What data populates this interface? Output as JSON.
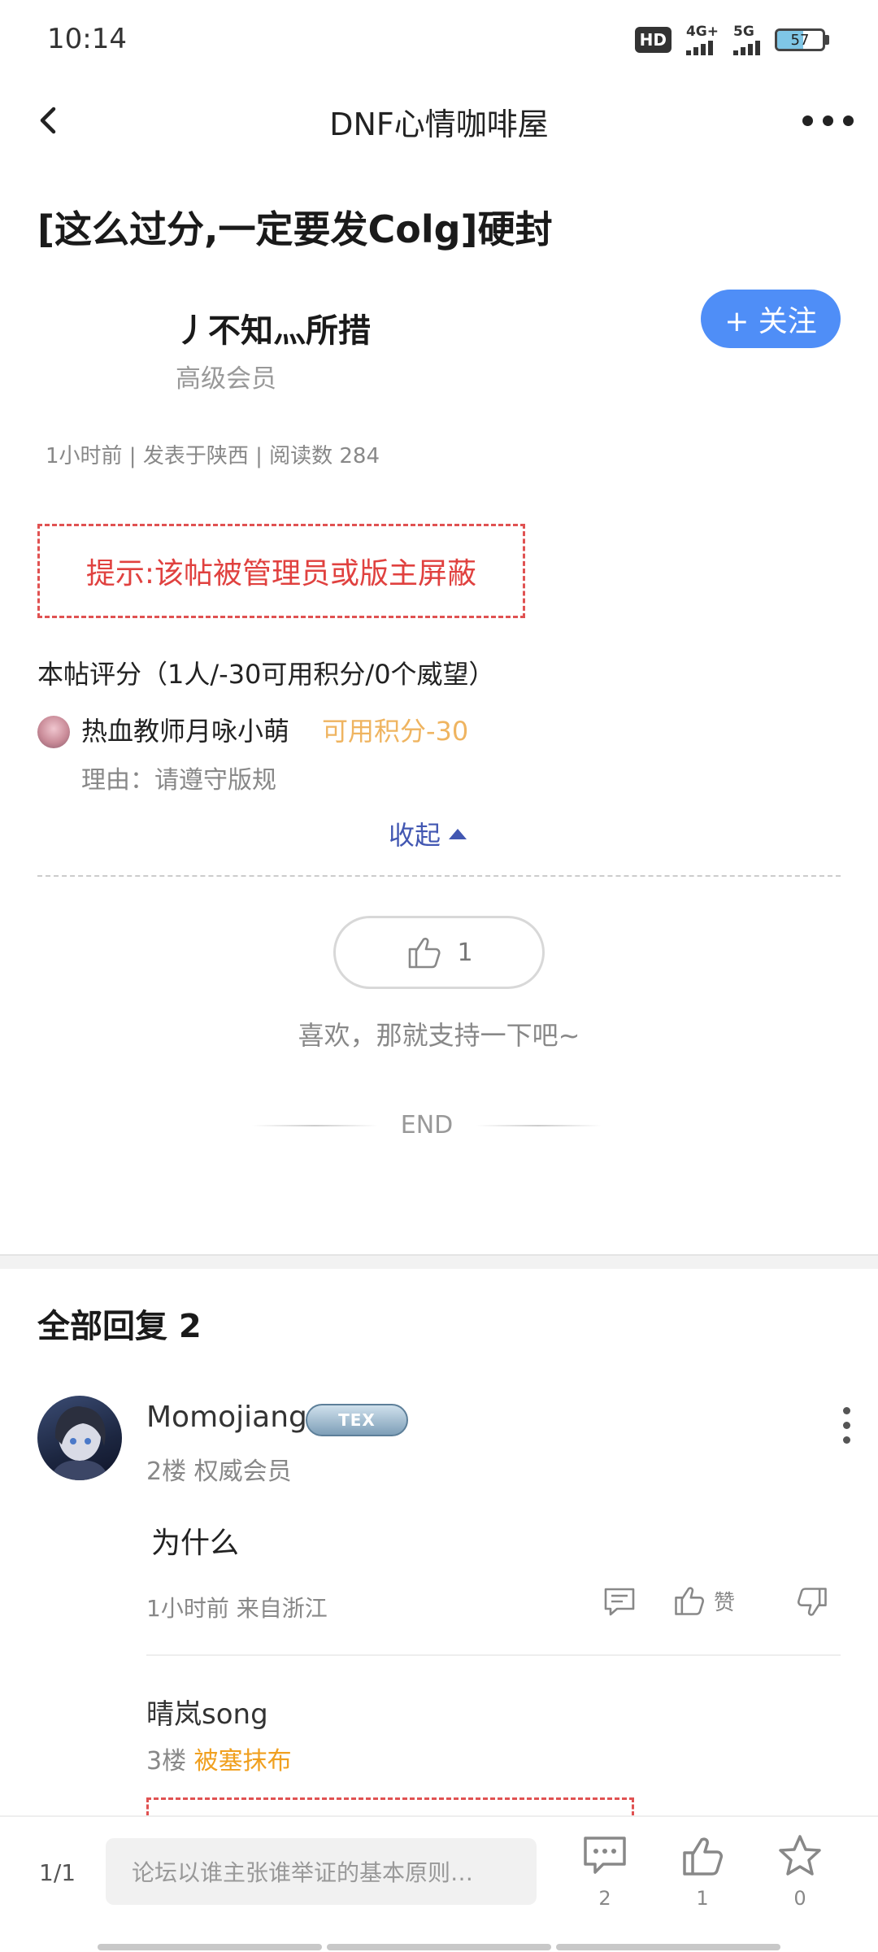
{
  "status_bar": {
    "time": "10:14",
    "hd_label": "HD",
    "network_1": "4G+",
    "network_2": "5G",
    "battery": "57",
    "battery_level": 0.57
  },
  "nav": {
    "title": "DNF心情咖啡屋",
    "back_icon": "chevron-left-icon",
    "more_icon": "more-horizontal-icon"
  },
  "post": {
    "title": "[这么过分,一定要发Colg]硬封",
    "author_name": "丿不知灬所措",
    "author_rank": "高级会员",
    "follow_label": "+ 关注",
    "meta": "1小时前 | 发表于陕西 | 阅读数 284",
    "notice": "提示:该帖被管理员或版主屏蔽",
    "rating_header": "本帖评分（1人/-30可用积分/0个威望）",
    "rater_name": "热血教师月咏小萌",
    "rater_score": "可用积分-30",
    "rater_reason": "理由：请遵守版规",
    "collapse_label": "收起",
    "like_count": "1",
    "like_hint": "喜欢，那就支持一下吧~",
    "end_label": "END"
  },
  "replies": {
    "header": "全部回复 2",
    "items": [
      {
        "name": "Momojiang",
        "badge": "TEX",
        "floor": "2楼 权威会员",
        "text": "为什么",
        "meta": "1小时前 来自浙江",
        "like_label": "赞"
      },
      {
        "name": "晴岚song",
        "floor_prefix": "3楼 ",
        "rank": "被塞抹布"
      }
    ]
  },
  "bottom_bar": {
    "page": "1/1",
    "input_placeholder": "论坛以谁主张谁举证的基本原则…",
    "comment_count": "2",
    "like_count": "1",
    "favorite_count": "0"
  },
  "colors": {
    "accent": "#4f8ef7",
    "notice_red": "#e0413f",
    "score_orange": "#efb460",
    "link_blue": "#4257b2"
  }
}
